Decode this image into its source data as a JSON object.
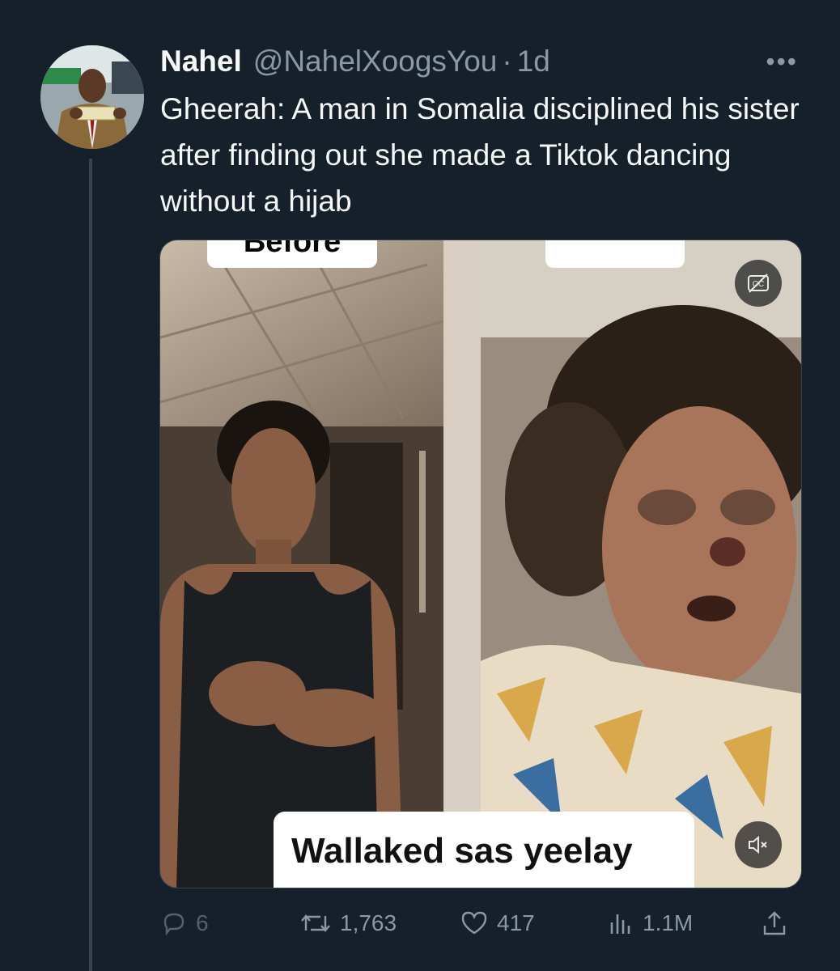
{
  "tweet": {
    "display_name": "Nahel",
    "handle": "@NahelXoogsYou",
    "separator": "·",
    "time": "1d",
    "text": "Gheerah: A man in Somalia disciplined his sister after finding out she made a Tiktok dancing without a hijab",
    "more_icon": "more-horizontal-icon"
  },
  "media": {
    "caption_top_left": "Before",
    "caption_bottom": "Wallaked sas yeelay",
    "cc_icon": "captions-off-icon",
    "mute_icon": "volume-muted-icon"
  },
  "actions": {
    "replies": "6",
    "retweets": "1,763",
    "likes": "417",
    "views": "1.1M"
  },
  "colors": {
    "background": "#15202b",
    "text_primary": "#f7f9f9",
    "text_secondary": "#8b98a5",
    "divider": "#38444d"
  }
}
